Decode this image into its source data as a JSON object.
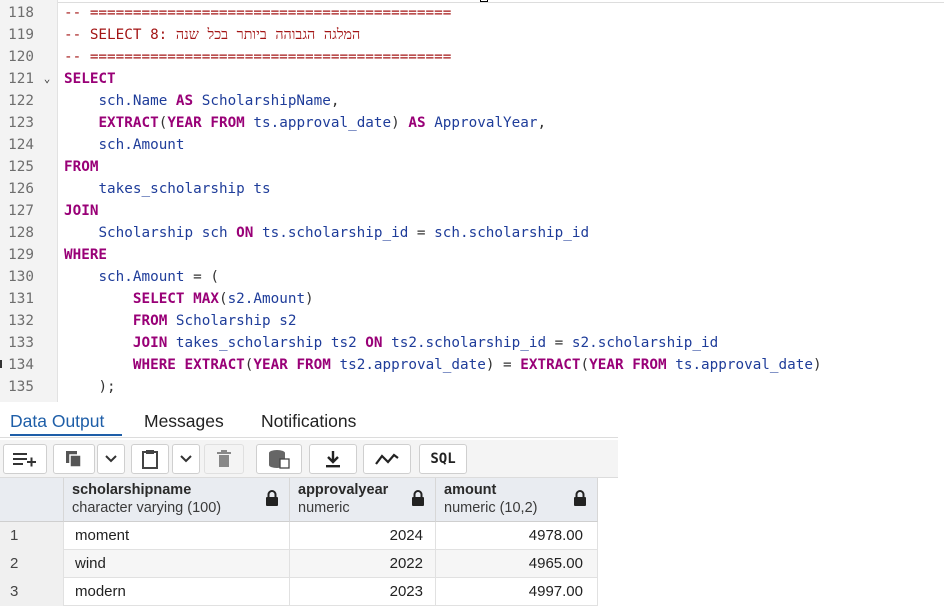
{
  "editor": {
    "lines": [
      {
        "n": "118",
        "fold": "",
        "tokens": [
          {
            "t": "-- ==========================================",
            "c": "cm"
          }
        ]
      },
      {
        "n": "119",
        "fold": "",
        "tokens": [
          {
            "t": "-- SELECT 8: המלגה הגבוהה ביותר בכל שנה",
            "c": "cm"
          }
        ]
      },
      {
        "n": "120",
        "fold": "",
        "tokens": [
          {
            "t": "-- ==========================================",
            "c": "cm"
          }
        ]
      },
      {
        "n": "121",
        "fold": "⌄",
        "tokens": [
          {
            "t": "SELECT",
            "c": "kw"
          }
        ]
      },
      {
        "n": "122",
        "fold": "",
        "tokens": [
          {
            "t": "    "
          },
          {
            "t": "sch.Name",
            "c": "id"
          },
          {
            "t": " "
          },
          {
            "t": "AS",
            "c": "kw"
          },
          {
            "t": " "
          },
          {
            "t": "ScholarshipName",
            "c": "id"
          },
          {
            "t": ",",
            "c": "op"
          }
        ]
      },
      {
        "n": "123",
        "fold": "",
        "tokens": [
          {
            "t": "    "
          },
          {
            "t": "EXTRACT",
            "c": "fn"
          },
          {
            "t": "(",
            "c": "op"
          },
          {
            "t": "YEAR",
            "c": "kw"
          },
          {
            "t": " "
          },
          {
            "t": "FROM",
            "c": "kw"
          },
          {
            "t": " "
          },
          {
            "t": "ts.approval_date",
            "c": "id"
          },
          {
            "t": ") ",
            "c": "op"
          },
          {
            "t": "AS",
            "c": "kw"
          },
          {
            "t": " "
          },
          {
            "t": "ApprovalYear",
            "c": "id"
          },
          {
            "t": ",",
            "c": "op"
          }
        ]
      },
      {
        "n": "124",
        "fold": "",
        "tokens": [
          {
            "t": "    "
          },
          {
            "t": "sch.Amount",
            "c": "id"
          }
        ]
      },
      {
        "n": "125",
        "fold": "",
        "tokens": [
          {
            "t": "FROM",
            "c": "kw"
          }
        ]
      },
      {
        "n": "126",
        "fold": "",
        "tokens": [
          {
            "t": "    "
          },
          {
            "t": "takes_scholarship ts",
            "c": "id"
          }
        ]
      },
      {
        "n": "127",
        "fold": "",
        "tokens": [
          {
            "t": "JOIN",
            "c": "kw"
          }
        ]
      },
      {
        "n": "128",
        "fold": "",
        "tokens": [
          {
            "t": "    "
          },
          {
            "t": "Scholarship sch",
            "c": "id"
          },
          {
            "t": " "
          },
          {
            "t": "ON",
            "c": "kw"
          },
          {
            "t": " "
          },
          {
            "t": "ts.scholarship_id",
            "c": "id"
          },
          {
            "t": " = ",
            "c": "op"
          },
          {
            "t": "sch.scholarship_id",
            "c": "id"
          }
        ]
      },
      {
        "n": "129",
        "fold": "",
        "tokens": [
          {
            "t": "WHERE",
            "c": "kw"
          }
        ]
      },
      {
        "n": "130",
        "fold": "",
        "tokens": [
          {
            "t": "    "
          },
          {
            "t": "sch.Amount",
            "c": "id"
          },
          {
            "t": " = (",
            "c": "op"
          }
        ]
      },
      {
        "n": "131",
        "fold": "",
        "tokens": [
          {
            "t": "        "
          },
          {
            "t": "SELECT",
            "c": "kw"
          },
          {
            "t": " "
          },
          {
            "t": "MAX",
            "c": "fn"
          },
          {
            "t": "(",
            "c": "op"
          },
          {
            "t": "s2.Amount",
            "c": "id"
          },
          {
            "t": ")",
            "c": "op"
          }
        ]
      },
      {
        "n": "132",
        "fold": "",
        "tokens": [
          {
            "t": "        "
          },
          {
            "t": "FROM",
            "c": "kw"
          },
          {
            "t": " "
          },
          {
            "t": "Scholarship s2",
            "c": "id"
          }
        ]
      },
      {
        "n": "133",
        "fold": "",
        "tokens": [
          {
            "t": "        "
          },
          {
            "t": "JOIN",
            "c": "kw"
          },
          {
            "t": " "
          },
          {
            "t": "takes_scholarship ts2",
            "c": "id"
          },
          {
            "t": " "
          },
          {
            "t": "ON",
            "c": "kw"
          },
          {
            "t": " "
          },
          {
            "t": "ts2.scholarship_id",
            "c": "id"
          },
          {
            "t": " = ",
            "c": "op"
          },
          {
            "t": "s2.scholarship_id",
            "c": "id"
          }
        ]
      },
      {
        "n": "134",
        "fold": "",
        "tokens": [
          {
            "t": "        "
          },
          {
            "t": "WHERE",
            "c": "kw"
          },
          {
            "t": " "
          },
          {
            "t": "EXTRACT",
            "c": "fn"
          },
          {
            "t": "(",
            "c": "op"
          },
          {
            "t": "YEAR",
            "c": "kw"
          },
          {
            "t": " "
          },
          {
            "t": "FROM",
            "c": "kw"
          },
          {
            "t": " "
          },
          {
            "t": "ts2.approval_date",
            "c": "id"
          },
          {
            "t": ") = ",
            "c": "op"
          },
          {
            "t": "EXTRACT",
            "c": "fn"
          },
          {
            "t": "(",
            "c": "op"
          },
          {
            "t": "YEAR",
            "c": "kw"
          },
          {
            "t": " "
          },
          {
            "t": "FROM",
            "c": "kw"
          },
          {
            "t": " "
          },
          {
            "t": "ts.approval_date",
            "c": "id"
          },
          {
            "t": ")",
            "c": "op"
          }
        ]
      },
      {
        "n": "135",
        "fold": "",
        "tokens": [
          {
            "t": "    "
          },
          {
            "t": ");",
            "c": "op"
          }
        ]
      }
    ]
  },
  "panel": {
    "tabs": [
      {
        "label": "Data Output",
        "active": true
      },
      {
        "label": "Messages",
        "active": false
      },
      {
        "label": "Notifications",
        "active": false
      }
    ],
    "toolbar": {
      "sql_label": "SQL",
      "icons": [
        "add-row-icon",
        "copy-icon",
        "chevron-down-icon",
        "paste-icon",
        "chevron-down-icon",
        "delete-icon",
        "save-data-icon",
        "download-icon",
        "graph-icon"
      ]
    },
    "columns": [
      {
        "name": "scholarshipname",
        "type": "character varying (100)"
      },
      {
        "name": "approvalyear",
        "type": "numeric"
      },
      {
        "name": "amount",
        "type": "numeric (10,2)"
      }
    ],
    "rows": [
      {
        "n": "1",
        "name": "moment",
        "year": "2024",
        "amount": "4978.00"
      },
      {
        "n": "2",
        "name": "wind",
        "year": "2022",
        "amount": "4965.00"
      },
      {
        "n": "3",
        "name": "modern",
        "year": "2023",
        "amount": "4997.00"
      }
    ]
  },
  "colors": {
    "keyword": "#990077",
    "identifier": "#1f3d9a",
    "comment": "#a31515",
    "active_tab": "#1e5ea8"
  }
}
